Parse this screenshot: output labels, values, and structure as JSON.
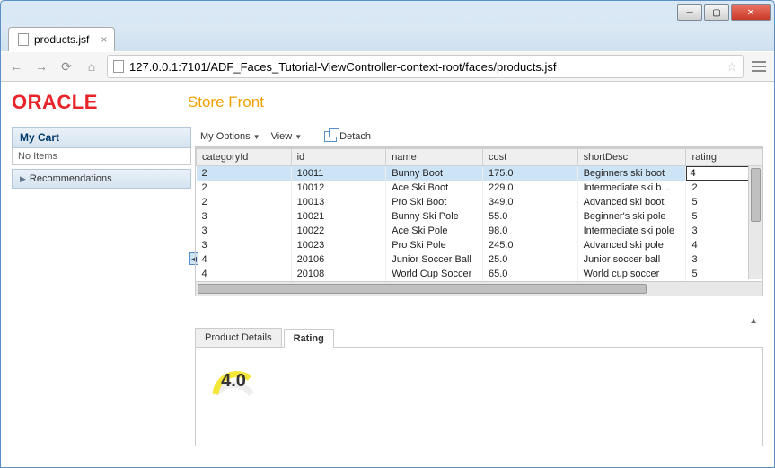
{
  "browser": {
    "tab_title": "products.jsf",
    "url": "127.0.0.1:7101/ADF_Faces_Tutorial-ViewController-context-root/faces/products.jsf"
  },
  "header": {
    "logo_text": "ORACLE",
    "page_title": "Store Front"
  },
  "sidebar": {
    "cart_header": "My Cart",
    "cart_status": "No Items",
    "accordion_label": "Recommendations"
  },
  "toolbar": {
    "options_label": "My Options",
    "view_label": "View",
    "detach_label": "Detach"
  },
  "table": {
    "columns": [
      "categoryId",
      "id",
      "name",
      "cost",
      "shortDesc",
      "rating"
    ],
    "rows": [
      {
        "categoryId": "2",
        "id": "10011",
        "name": "Bunny Boot",
        "cost": "175.0",
        "shortDesc": "Beginners ski boot",
        "rating": "4",
        "selected": true
      },
      {
        "categoryId": "2",
        "id": "10012",
        "name": "Ace Ski Boot",
        "cost": "229.0",
        "shortDesc": "Intermediate ski b...",
        "rating": "2",
        "selected": false
      },
      {
        "categoryId": "2",
        "id": "10013",
        "name": "Pro Ski Boot",
        "cost": "349.0",
        "shortDesc": "Advanced ski boot",
        "rating": "5",
        "selected": false
      },
      {
        "categoryId": "3",
        "id": "10021",
        "name": "Bunny Ski Pole",
        "cost": "55.0",
        "shortDesc": "Beginner's ski pole",
        "rating": "5",
        "selected": false
      },
      {
        "categoryId": "3",
        "id": "10022",
        "name": "Ace Ski Pole",
        "cost": "98.0",
        "shortDesc": "Intermediate ski pole",
        "rating": "3",
        "selected": false
      },
      {
        "categoryId": "3",
        "id": "10023",
        "name": "Pro Ski Pole",
        "cost": "245.0",
        "shortDesc": "Advanced ski pole",
        "rating": "4",
        "selected": false
      },
      {
        "categoryId": "4",
        "id": "20106",
        "name": "Junior Soccer Ball",
        "cost": "25.0",
        "shortDesc": "Junior soccer ball",
        "rating": "3",
        "selected": false
      },
      {
        "categoryId": "4",
        "id": "20108",
        "name": "World Cup Soccer",
        "cost": "65.0",
        "shortDesc": "World cup soccer",
        "rating": "5",
        "selected": false
      }
    ]
  },
  "detail": {
    "tabs": [
      "Product Details",
      "Rating"
    ],
    "active_tab": 1,
    "rating_value": "4.0"
  }
}
